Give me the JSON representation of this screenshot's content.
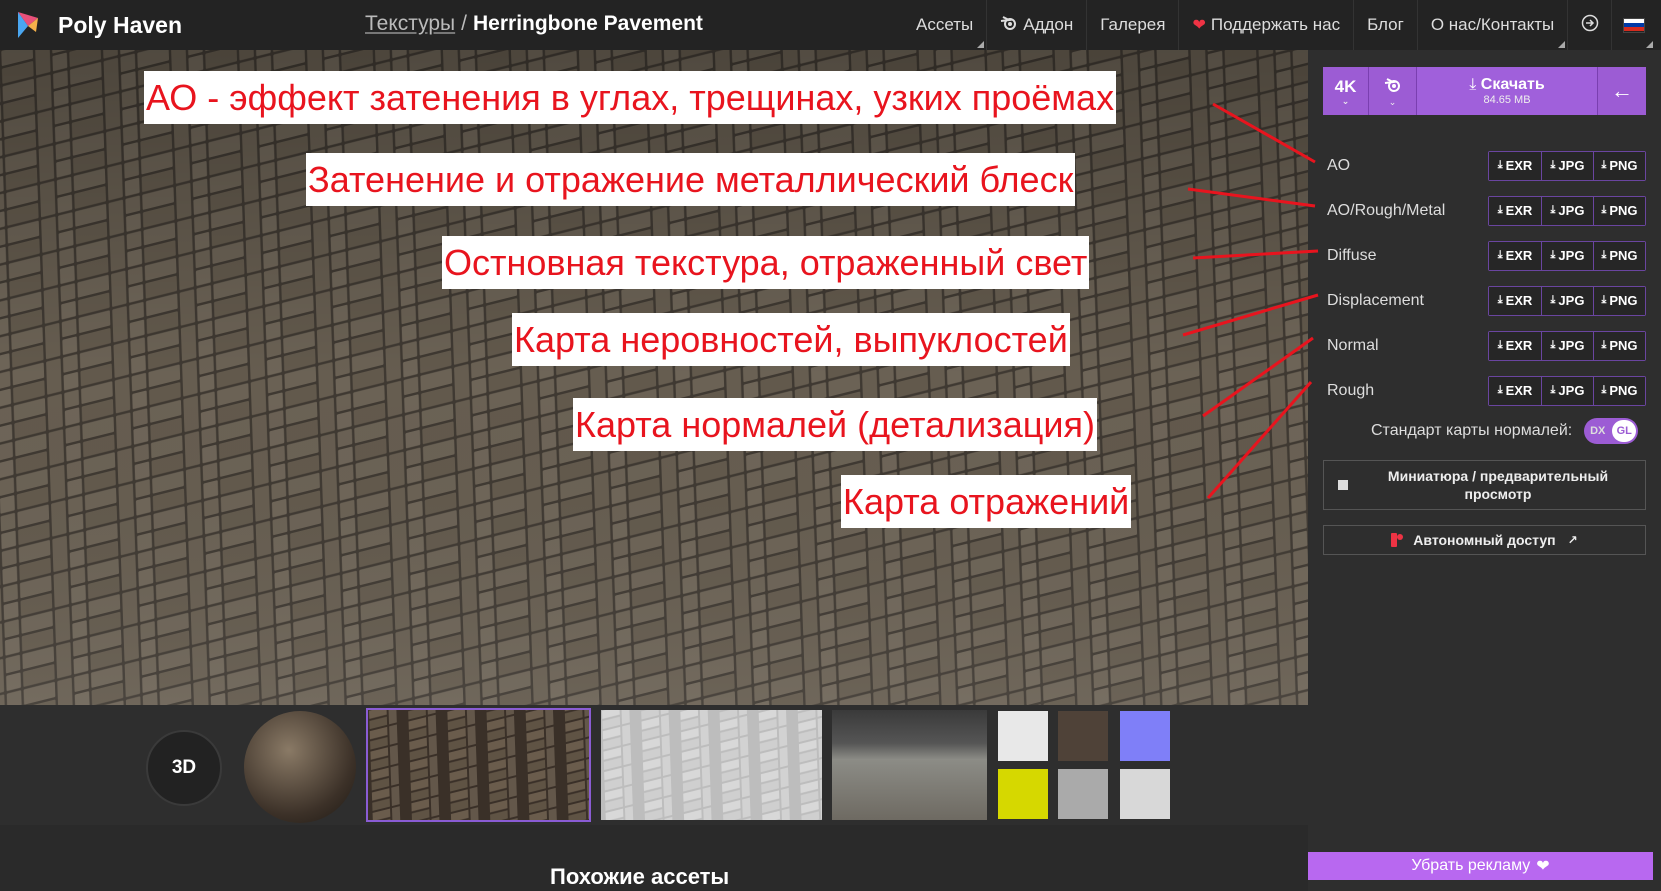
{
  "header": {
    "brand": "Poly Haven",
    "breadcrumb": {
      "parent": "Текстуры",
      "separator": "/",
      "current": "Herringbone Pavement"
    },
    "nav": [
      {
        "label": "Ассеты",
        "icon": ""
      },
      {
        "label": "Аддон",
        "icon": "blender-icon"
      },
      {
        "label": "Галерея",
        "icon": ""
      },
      {
        "label": "Поддержать нас",
        "icon": "heart-icon"
      },
      {
        "label": "Блог",
        "icon": ""
      },
      {
        "label": "О нас/Контакты",
        "icon": ""
      }
    ],
    "flag_colors": [
      "#ffffff",
      "#0039a6",
      "#d52b1e"
    ]
  },
  "download": {
    "resolution": "4K",
    "label": "Скачать",
    "size": "84.65 MB"
  },
  "maps": [
    {
      "name": "AO",
      "formats": [
        "EXR",
        "JPG",
        "PNG"
      ]
    },
    {
      "name": "AO/Rough/Metal",
      "formats": [
        "EXR",
        "JPG",
        "PNG"
      ]
    },
    {
      "name": "Diffuse",
      "formats": [
        "EXR",
        "JPG",
        "PNG"
      ]
    },
    {
      "name": "Displacement",
      "formats": [
        "EXR",
        "JPG",
        "PNG"
      ]
    },
    {
      "name": "Normal",
      "formats": [
        "EXR",
        "JPG",
        "PNG"
      ]
    },
    {
      "name": "Rough",
      "formats": [
        "EXR",
        "JPG",
        "PNG"
      ]
    }
  ],
  "normal_standard": {
    "label": "Стандарт карты нормалей:",
    "options": [
      "DX",
      "GL"
    ],
    "selected": "GL"
  },
  "preview_label": "Миниатюра / предварительный просмотр",
  "offline_label": "Автономный доступ",
  "remove_ads_label": "Убрать рекламу",
  "viewer_3d_label": "3D",
  "similar_assets_label": "Похожие ассеты",
  "annotations": [
    "АО - эффект затенения в углах, трещинах, узких проёмах",
    "Затенение и отражение металлический блеск",
    "Остновная текстура, отраженный свет",
    "Карта неровностей, выпуклостей",
    "Карта нормалей (детализация)",
    "Карта отражений"
  ],
  "colors": {
    "accent": "#9c5cd4",
    "annotation_red": "#e8141e",
    "header_bg": "#232323",
    "sidebar_bg": "#2e2e2e"
  },
  "thumbnail_swatches": [
    "#e8e8e8",
    "#4f4238",
    "#7f7ff8",
    "#d6d800",
    "#aaaaaa",
    "#d8d8d8"
  ]
}
